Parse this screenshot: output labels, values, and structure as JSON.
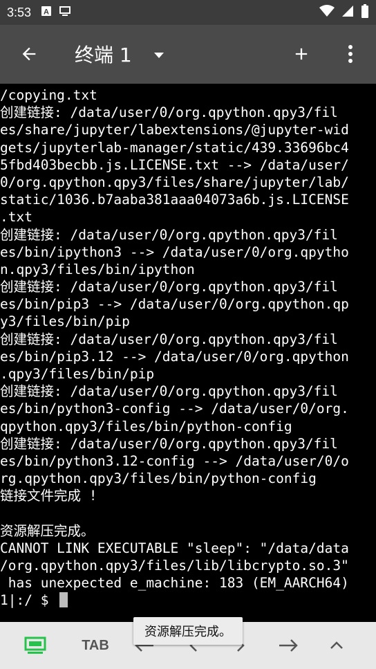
{
  "status_bar": {
    "time": "3:53",
    "notification_icons": [
      "font-a-icon",
      "screen-icon"
    ],
    "status_icons": [
      "wifi-icon",
      "signal-icon",
      "battery-icon"
    ]
  },
  "app_bar": {
    "title": "终端 1",
    "back_icon": "arrow-back-icon",
    "dropdown_icon": "caret-down-icon",
    "add_icon": "plus-icon",
    "more_icon": "more-vert-icon"
  },
  "terminal": {
    "lines": [
      "/copying.txt",
      "创建链接: /data/user/0/org.qpython.qpy3/fil",
      "es/share/jupyter/labextensions/@jupyter-wid",
      "gets/jupyterlab-manager/static/439.33696bc4",
      "5fbd403becbb.js.LICENSE.txt --> /data/user/",
      "0/org.qpython.qpy3/files/share/jupyter/lab/",
      "static/1036.b7aaba381aaa04073a6b.js.LICENSE",
      ".txt",
      "创建链接: /data/user/0/org.qpython.qpy3/fil",
      "es/bin/ipython3 --> /data/user/0/org.qpytho",
      "n.qpy3/files/bin/ipython",
      "创建链接: /data/user/0/org.qpython.qpy3/fil",
      "es/bin/pip3 --> /data/user/0/org.qpython.qp",
      "y3/files/bin/pip",
      "创建链接: /data/user/0/org.qpython.qpy3/fil",
      "es/bin/pip3.12 --> /data/user/0/org.qpython",
      ".qpy3/files/bin/pip",
      "创建链接: /data/user/0/org.qpython.qpy3/fil",
      "es/bin/python3-config --> /data/user/0/org.",
      "qpython.qpy3/files/bin/python-config",
      "创建链接: /data/user/0/org.qpython.qpy3/fil",
      "es/bin/python3.12-config --> /data/user/0/o",
      "rg.qpython.qpy3/files/bin/python-config",
      "链接文件完成 !",
      "",
      "资源解压完成。",
      "CANNOT LINK EXECUTABLE \"sleep\": \"/data/data",
      "/org.qpython.qpy3/files/lib/libcrypto.so.3\"",
      " has unexpected e_machine: 183 (EM_AARCH64)"
    ],
    "prompt": "1|:/ $ "
  },
  "extra_keys": {
    "keyboard_icon": "keyboard-toggle-icon",
    "tab_label": "TAB",
    "keys": [
      "arrow-left-long-icon",
      "chevron-left-icon",
      "chevron-right-icon",
      "arrow-right-long-icon",
      "chevron-up-icon"
    ]
  },
  "toast": {
    "text": "资源解压完成。"
  },
  "colors": {
    "status_bar": "#3c3c3c",
    "app_bar": "#4a4a4a",
    "terminal_bg": "#000000",
    "terminal_fg": "#ffffff",
    "extra_keys_bg": "#e8e8e8",
    "keyboard_icon": "#27c24c"
  }
}
